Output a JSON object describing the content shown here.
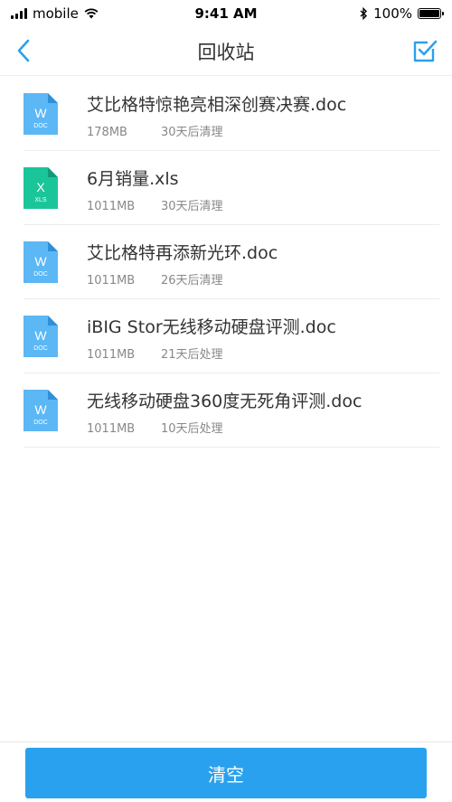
{
  "status_bar": {
    "carrier": "mobile",
    "time": "9:41 AM",
    "battery": "100%"
  },
  "nav": {
    "title": "回收站",
    "back_icon": "chevron-left-icon",
    "edit_icon": "checkbox-edit-icon"
  },
  "colors": {
    "accent": "#2aa1ee",
    "doc_icon": "#5cb7f5",
    "xls_icon": "#1bc59a"
  },
  "files": [
    {
      "name": "艾比格特惊艳亮相深创赛决赛.doc",
      "size": "178MB",
      "expiry": "30天后清理",
      "type_label": "W",
      "type_sub": "DOC"
    },
    {
      "name": "6月销量.xls",
      "size": "1011MB",
      "expiry": "30天后清理",
      "type_label": "X",
      "type_sub": "XLS"
    },
    {
      "name": "艾比格特再添新光环.doc",
      "size": "1011MB",
      "expiry": "26天后清理",
      "type_label": "W",
      "type_sub": "DOC"
    },
    {
      "name": "iBIG Stor无线移动硬盘评测.doc",
      "size": "1011MB",
      "expiry": "21天后处理",
      "type_label": "W",
      "type_sub": "DOC"
    },
    {
      "name": "无线移动硬盘360度无死角评测.doc",
      "size": "1011MB",
      "expiry": "10天后处理",
      "type_label": "W",
      "type_sub": "DOC"
    }
  ],
  "bottom": {
    "clear_label": "清空"
  }
}
